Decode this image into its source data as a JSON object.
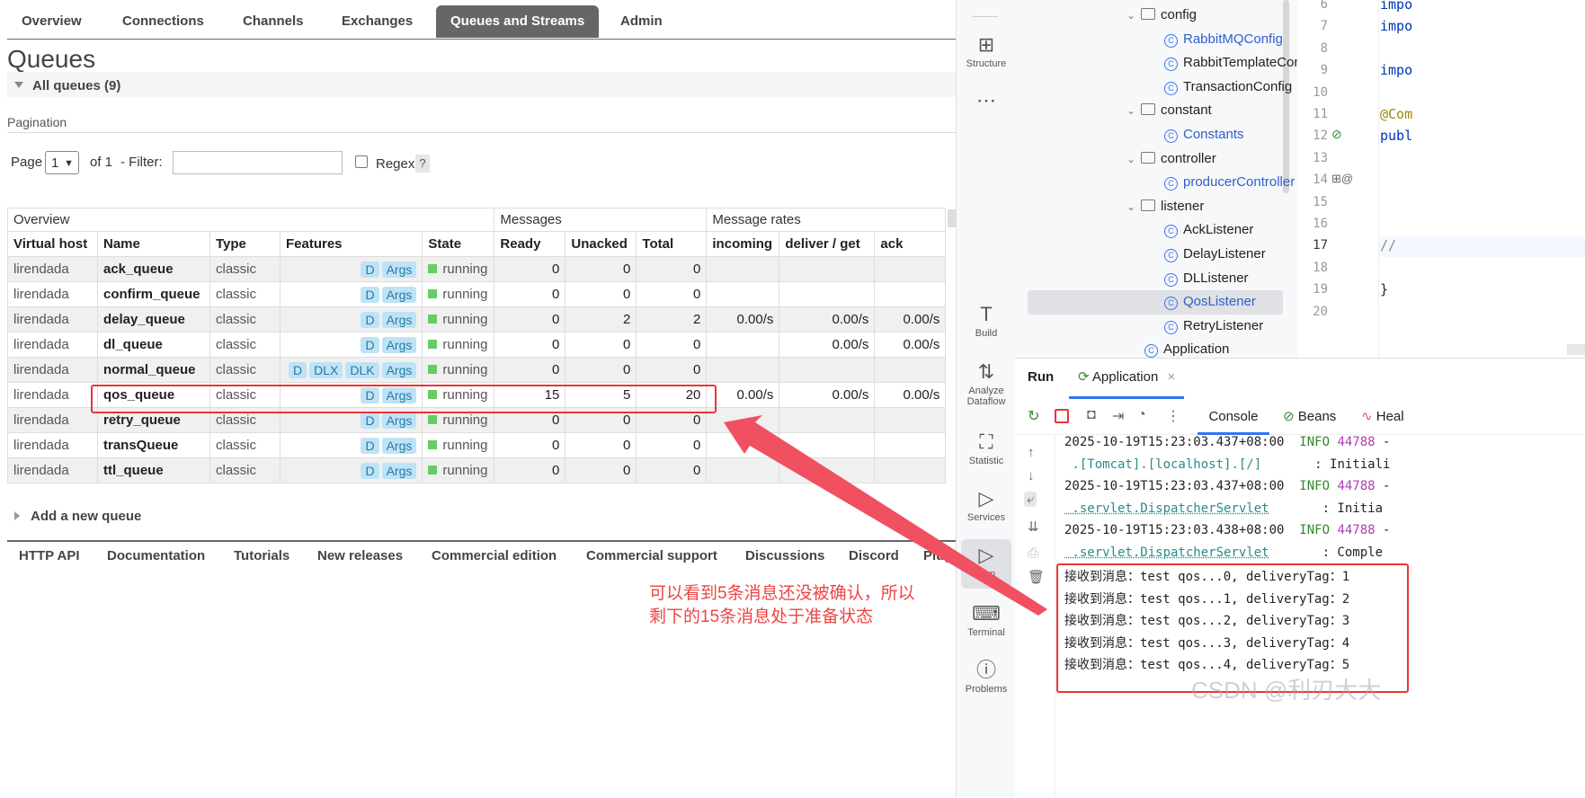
{
  "rmq": {
    "tabs": [
      "Overview",
      "Connections",
      "Channels",
      "Exchanges",
      "Queues and Streams",
      "Admin"
    ],
    "active_tab": "Queues and Streams",
    "page_title": "Queues",
    "section_label": "All queues (9)",
    "pagination": {
      "label": "Pagination",
      "page_label": "Page",
      "page_value": "1",
      "of_label": "of 1",
      "filter_label": "- Filter:",
      "filter_value": "",
      "regex_label": "Regex",
      "help": "?"
    },
    "table": {
      "groups": [
        "Overview",
        "Messages",
        "Message rates"
      ],
      "columns": [
        "Virtual host",
        "Name",
        "Type",
        "Features",
        "State",
        "Ready",
        "Unacked",
        "Total",
        "incoming",
        "deliver / get",
        "ack"
      ],
      "rows": [
        {
          "vhost": "lirendada",
          "name": "ack_queue",
          "type": "classic",
          "features": [
            "D",
            "Args"
          ],
          "state": "running",
          "ready": "0",
          "unacked": "0",
          "total": "0",
          "incoming": "",
          "deliver": "",
          "ack": ""
        },
        {
          "vhost": "lirendada",
          "name": "confirm_queue",
          "type": "classic",
          "features": [
            "D",
            "Args"
          ],
          "state": "running",
          "ready": "0",
          "unacked": "0",
          "total": "0",
          "incoming": "",
          "deliver": "",
          "ack": ""
        },
        {
          "vhost": "lirendada",
          "name": "delay_queue",
          "type": "classic",
          "features": [
            "D",
            "Args"
          ],
          "state": "running",
          "ready": "0",
          "unacked": "2",
          "total": "2",
          "incoming": "0.00/s",
          "deliver": "0.00/s",
          "ack": "0.00/s"
        },
        {
          "vhost": "lirendada",
          "name": "dl_queue",
          "type": "classic",
          "features": [
            "D",
            "Args"
          ],
          "state": "running",
          "ready": "0",
          "unacked": "0",
          "total": "0",
          "incoming": "",
          "deliver": "0.00/s",
          "ack": "0.00/s"
        },
        {
          "vhost": "lirendada",
          "name": "normal_queue",
          "type": "classic",
          "features": [
            "D",
            "DLX",
            "DLK",
            "Args"
          ],
          "state": "running",
          "ready": "0",
          "unacked": "0",
          "total": "0",
          "incoming": "",
          "deliver": "",
          "ack": ""
        },
        {
          "vhost": "lirendada",
          "name": "qos_queue",
          "type": "classic",
          "features": [
            "D",
            "Args"
          ],
          "state": "running",
          "ready": "15",
          "unacked": "5",
          "total": "20",
          "incoming": "0.00/s",
          "deliver": "0.00/s",
          "ack": "0.00/s"
        },
        {
          "vhost": "lirendada",
          "name": "retry_queue",
          "type": "classic",
          "features": [
            "D",
            "Args"
          ],
          "state": "running",
          "ready": "0",
          "unacked": "0",
          "total": "0",
          "incoming": "",
          "deliver": "",
          "ack": ""
        },
        {
          "vhost": "lirendada",
          "name": "transQueue",
          "type": "classic",
          "features": [
            "D",
            "Args"
          ],
          "state": "running",
          "ready": "0",
          "unacked": "0",
          "total": "0",
          "incoming": "",
          "deliver": "",
          "ack": ""
        },
        {
          "vhost": "lirendada",
          "name": "ttl_queue",
          "type": "classic",
          "features": [
            "D",
            "Args"
          ],
          "state": "running",
          "ready": "0",
          "unacked": "0",
          "total": "0",
          "incoming": "",
          "deliver": "",
          "ack": ""
        }
      ]
    },
    "add_queue": "Add a new queue",
    "footer_links": [
      "HTTP API",
      "Documentation",
      "Tutorials",
      "New releases",
      "Commercial edition",
      "Commercial support",
      "Discussions",
      "Discord",
      "Plugi"
    ],
    "annotation": [
      "可以看到5条消息还没被确认，所以",
      "剩下的15条消息处于准备状态"
    ],
    "colors": {
      "annotation": "#ee4444",
      "running": "#66cc66",
      "badge_bg": "#bfe3f6",
      "badge_fg": "#267aa5"
    }
  },
  "ide": {
    "tools": [
      {
        "icon": "structure-icon",
        "glyph": "⊞",
        "label": "Structure"
      },
      {
        "icon": "more-icon",
        "glyph": "⋯",
        "label": ""
      },
      {
        "icon": "build-icon",
        "glyph": "T",
        "label": "Build"
      },
      {
        "icon": "analyze-dataflow-icon",
        "glyph": "⇅",
        "label": "Analyze\nDataflow"
      },
      {
        "icon": "statistic-icon",
        "glyph": "⛶",
        "label": "Statistic"
      },
      {
        "icon": "services-icon",
        "glyph": "▷",
        "label": "Services"
      },
      {
        "icon": "run-icon",
        "glyph": "▷",
        "label": "Run"
      },
      {
        "icon": "terminal-icon",
        "glyph": "⌨",
        "label": "Terminal"
      },
      {
        "icon": "problems-icon",
        "glyph": "ⓘ",
        "label": "Problems"
      }
    ],
    "tree": [
      {
        "type": "folder",
        "label": "config",
        "indent": 1,
        "expanded": true
      },
      {
        "type": "class",
        "label": "RabbitMQConfig",
        "indent": 2,
        "blue": true
      },
      {
        "type": "class",
        "label": "RabbitTemplateCon",
        "indent": 2
      },
      {
        "type": "class",
        "label": "TransactionConfig",
        "indent": 2
      },
      {
        "type": "folder",
        "label": "constant",
        "indent": 1,
        "expanded": true
      },
      {
        "type": "class",
        "label": "Constants",
        "indent": 2,
        "blue": true
      },
      {
        "type": "folder",
        "label": "controller",
        "indent": 1,
        "expanded": true
      },
      {
        "type": "class",
        "label": "producerController",
        "indent": 2,
        "blue": true
      },
      {
        "type": "folder",
        "label": "listener",
        "indent": 1,
        "expanded": true
      },
      {
        "type": "class",
        "label": "AckListener",
        "indent": 2
      },
      {
        "type": "class",
        "label": "DelayListener",
        "indent": 2
      },
      {
        "type": "class",
        "label": "DLListener",
        "indent": 2
      },
      {
        "type": "class",
        "label": "QosListener",
        "indent": 2,
        "blue": true,
        "selected": true
      },
      {
        "type": "class",
        "label": "RetryListener",
        "indent": 2
      },
      {
        "type": "class",
        "label": "Application",
        "indent": 1
      }
    ],
    "editor": {
      "line_numbers": [
        "6",
        "7",
        "8",
        "9",
        "10",
        "11",
        "12",
        "13",
        "14",
        "15",
        "16",
        "17",
        "18",
        "19",
        "20"
      ],
      "code": [
        {
          "line": "6",
          "text": "impo"
        },
        {
          "line": "7",
          "text": "impo"
        },
        {
          "line": "9",
          "text": "impo"
        },
        {
          "line": "11",
          "text": "@Com"
        },
        {
          "line": "12",
          "text": "publ"
        },
        {
          "line": "17",
          "text": "//"
        },
        {
          "line": "19",
          "text": "}"
        }
      ]
    },
    "run": {
      "title": "Run",
      "tab": "Application",
      "tabs": [
        "Console",
        "Beans",
        "Heal"
      ],
      "console": [
        {
          "parts": [
            [
              "2025-10-19T15:23:03.437+08:00  ",
              ""
            ],
            [
              "INFO",
              "green"
            ],
            [
              " ",
              ""
            ],
            [
              "44788",
              "pid"
            ],
            [
              " -",
              ""
            ]
          ]
        },
        {
          "parts": [
            [
              " .[Tomcat].[localhost].[/]",
              "cyan"
            ],
            [
              "       : Initiali",
              ""
            ]
          ]
        },
        {
          "parts": [
            [
              "2025-10-19T15:23:03.437+08:00  ",
              ""
            ],
            [
              "INFO",
              "green"
            ],
            [
              " ",
              ""
            ],
            [
              "44788",
              "pid"
            ],
            [
              " -",
              ""
            ]
          ]
        },
        {
          "parts": [
            [
              " .servlet.DispatcherServlet",
              "cyan-dot"
            ],
            [
              "       : Initia",
              ""
            ]
          ]
        },
        {
          "parts": [
            [
              "2025-10-19T15:23:03.438+08:00  ",
              ""
            ],
            [
              "INFO",
              "green"
            ],
            [
              " ",
              ""
            ],
            [
              "44788",
              "pid"
            ],
            [
              " -",
              ""
            ]
          ]
        },
        {
          "parts": [
            [
              " .servlet.DispatcherServlet",
              "cyan-dot"
            ],
            [
              "       : Comple",
              ""
            ]
          ]
        },
        {
          "parts": [
            [
              "接收到消息：test qos...0, deliveryTag：1",
              ""
            ]
          ]
        },
        {
          "parts": [
            [
              "接收到消息：test qos...1, deliveryTag：2",
              ""
            ]
          ]
        },
        {
          "parts": [
            [
              "接收到消息：test qos...2, deliveryTag：3",
              ""
            ]
          ]
        },
        {
          "parts": [
            [
              "接收到消息：test qos...3, deliveryTag：4",
              ""
            ]
          ]
        },
        {
          "parts": [
            [
              "接收到消息：test qos...4, deliveryTag：5",
              ""
            ]
          ]
        }
      ]
    },
    "watermark": "CSDN @利刃大大"
  }
}
